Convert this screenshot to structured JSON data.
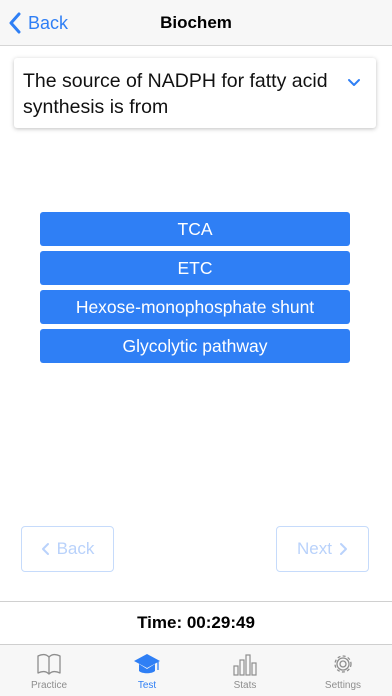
{
  "navbar": {
    "back_label": "Back",
    "title": "Biochem"
  },
  "question": {
    "text": "The source of NADPH for fatty acid synthesis is from"
  },
  "answers": [
    {
      "label": "TCA"
    },
    {
      "label": "ETC"
    },
    {
      "label": "Hexose-monophosphate shunt"
    },
    {
      "label": "Glycolytic pathway"
    }
  ],
  "pager": {
    "back_label": "Back",
    "next_label": "Next"
  },
  "timer": {
    "text": "Time: 00:29:49"
  },
  "tabs": [
    {
      "label": "Practice",
      "icon": "book-icon",
      "active": false
    },
    {
      "label": "Test",
      "icon": "graduation-cap-icon",
      "active": true
    },
    {
      "label": "Stats",
      "icon": "bar-chart-icon",
      "active": false
    },
    {
      "label": "Settings",
      "icon": "gear-icon",
      "active": false
    }
  ],
  "colors": {
    "accent": "#2f7ff5",
    "disabled": "#b9d2fb",
    "tab_inactive": "#8e8e8e"
  }
}
